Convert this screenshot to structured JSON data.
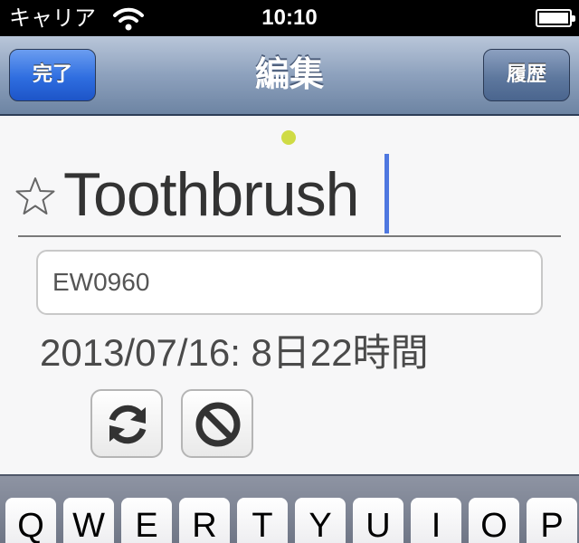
{
  "status_bar": {
    "carrier": "キャリア",
    "time": "10:10",
    "wifi_icon": "wifi-icon",
    "battery_icon": "battery-icon"
  },
  "nav": {
    "title": "編集",
    "left_button": "完了",
    "right_button": "履歴"
  },
  "item": {
    "favorite_icon": "star-outline-icon",
    "name": "Toothbrush",
    "code": "EW0960",
    "date_info": "2013/07/16: 8日22時間"
  },
  "actions": {
    "refresh_icon": "refresh-icon",
    "cancel_icon": "prohibit-icon"
  },
  "keyboard": {
    "keys": [
      "Q",
      "W",
      "E",
      "R",
      "T",
      "Y",
      "U",
      "I",
      "O",
      "P"
    ]
  },
  "colors": {
    "done_button": "#2f6ee0",
    "nav_bar": "#8da1bd",
    "cursor": "#4e78e0",
    "indicator_dot": "#cfdb45"
  }
}
